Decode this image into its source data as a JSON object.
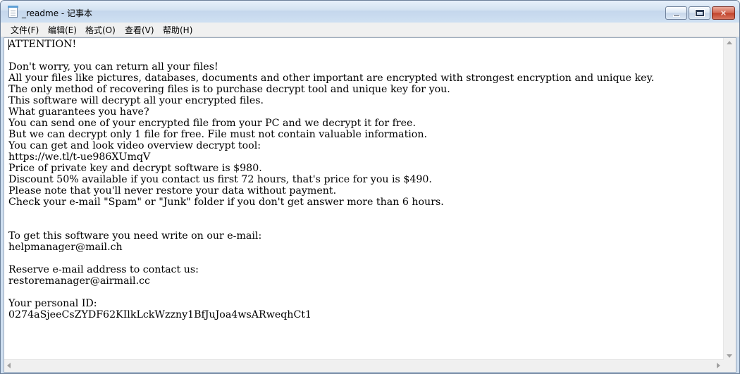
{
  "window": {
    "title": "_readme - 记事本",
    "icon": "notepad-icon"
  },
  "menu": {
    "items": [
      {
        "label": "文件(F)"
      },
      {
        "label": "编辑(E)"
      },
      {
        "label": "格式(O)"
      },
      {
        "label": "查看(V)"
      },
      {
        "label": "帮助(H)"
      }
    ]
  },
  "document": {
    "content": "ATTENTION!\n\nDon't worry, you can return all your files!\nAll your files like pictures, databases, documents and other important are encrypted with strongest encryption and unique key.\nThe only method of recovering files is to purchase decrypt tool and unique key for you.\nThis software will decrypt all your encrypted files.\nWhat guarantees you have?\nYou can send one of your encrypted file from your PC and we decrypt it for free.\nBut we can decrypt only 1 file for free. File must not contain valuable information.\nYou can get and look video overview decrypt tool:\nhttps://we.tl/t-ue986XUmqV\nPrice of private key and decrypt software is $980.\nDiscount 50% available if you contact us first 72 hours, that's price for you is $490.\nPlease note that you'll never restore your data without payment.\nCheck your e-mail \"Spam\" or \"Junk\" folder if you don't get answer more than 6 hours.\n\n\nTo get this software you need write on our e-mail:\nhelpmanager@mail.ch\n\nReserve e-mail address to contact us:\nrestoremanager@airmail.cc\n\nYour personal ID:\n0274aSjeeCsZYDF62KIlkLckWzzny1BfJuJoa4wsARweqhCt1"
  }
}
